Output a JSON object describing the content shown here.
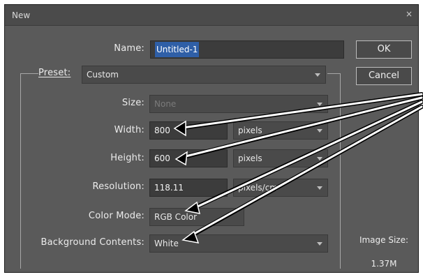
{
  "window": {
    "title": "New",
    "close_glyph": "×"
  },
  "form": {
    "name_label": "Name:",
    "name_value": "Untitled-1",
    "preset_label": "Preset:",
    "preset_value": "Custom",
    "size_label": "Size:",
    "size_value": "None",
    "width_label": "Width:",
    "width_value": "800",
    "width_unit": "pixels",
    "height_label": "Height:",
    "height_value": "600",
    "height_unit": "pixels",
    "resolution_label": "Resolution:",
    "resolution_value": "118.11",
    "resolution_unit": "pixels/cm",
    "color_mode_label": "Color Mode:",
    "color_mode_value": "RGB Color",
    "background_label": "Background Contents:",
    "background_value": "White"
  },
  "buttons": {
    "ok": "OK",
    "cancel": "Cancel"
  },
  "image_size": {
    "label": "Image Size:",
    "value": "1.37M"
  },
  "colors": {
    "window_bg": "#5a5a5a",
    "field_bg": "#3c3c3c",
    "selection_bg": "#2f5fa7",
    "arrow_fill": "#ffffff",
    "arrow_outline": "#000000"
  },
  "icons": {
    "close": "close-icon",
    "dropdown": "chevron-down-icon"
  }
}
